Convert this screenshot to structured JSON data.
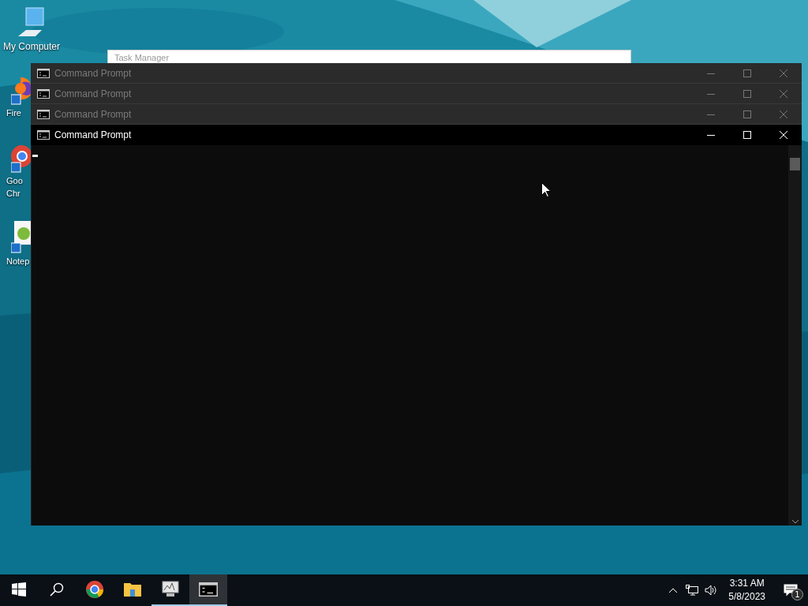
{
  "desktop_icons": [
    {
      "kind": "computer",
      "lines": [
        "My Computer"
      ]
    },
    {
      "kind": "firefox",
      "lines": [
        "Fire"
      ]
    },
    {
      "kind": "chrome",
      "lines": [
        "Goo",
        "Chr"
      ]
    },
    {
      "kind": "notepad",
      "lines": [
        "Notep"
      ]
    }
  ],
  "background_window": {
    "title": "Task Manager"
  },
  "windows": [
    {
      "title": "Command Prompt",
      "active": false
    },
    {
      "title": "Command Prompt",
      "active": false
    },
    {
      "title": "Command Prompt",
      "active": false
    },
    {
      "title": "Command Prompt",
      "active": true
    }
  ],
  "taskbar": {
    "apps": [
      {
        "kind": "chrome",
        "running": false,
        "selected": false
      },
      {
        "kind": "explorer",
        "running": false,
        "selected": false
      },
      {
        "kind": "taskmgr",
        "running": true,
        "selected": false
      },
      {
        "kind": "cmd",
        "running": true,
        "selected": true
      }
    ],
    "clock": {
      "time": "3:31 AM",
      "date": "5/8/2023"
    },
    "notifications": {
      "count": "1"
    }
  }
}
